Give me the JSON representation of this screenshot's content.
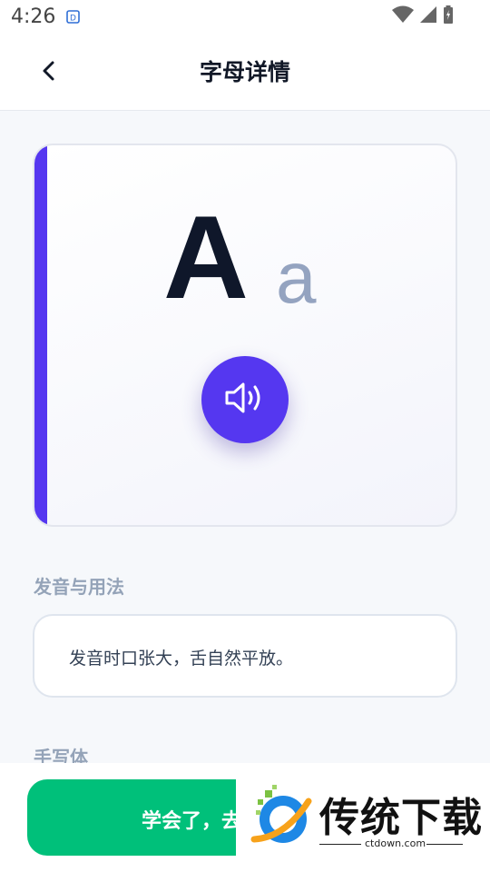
{
  "status_bar": {
    "time": "4:26"
  },
  "header": {
    "title": "字母详情"
  },
  "letter": {
    "upper": "A",
    "lower": "a"
  },
  "pronunciation": {
    "section_label": "发音与用法",
    "text": "发音时口张大，舌自然平放。"
  },
  "handwriting": {
    "section_label": "手写体"
  },
  "actions": {
    "learned_label": "学会了，去"
  },
  "watermark": {
    "title": "传统下载",
    "url": "ctdown.com"
  },
  "colors": {
    "accent": "#5537f0",
    "primary_button": "#00c07a",
    "muted_text": "#94a3b8"
  }
}
